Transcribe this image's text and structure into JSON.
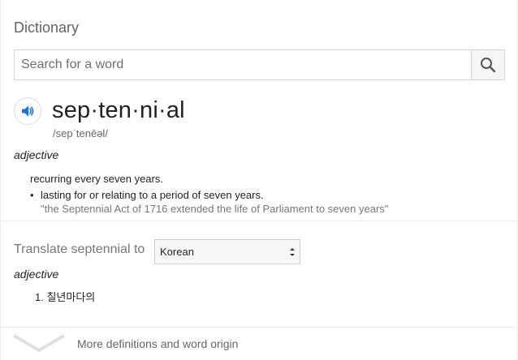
{
  "panel": {
    "title": "Dictionary"
  },
  "search": {
    "placeholder": "Search for a word",
    "value": "",
    "button_icon": "search-icon"
  },
  "entry": {
    "speaker_icon": "speaker-icon",
    "headword": "sep·ten·ni·al",
    "phonetic": "/sepˈtenēəl/",
    "part_of_speech": "adjective",
    "definition": "recurring every seven years.",
    "sub_definition": "lasting for or relating to a period of seven years.",
    "example": "\"the Septennial Act of 1716 extended the life of Parliament to seven years\""
  },
  "translate": {
    "label": "Translate septennial to",
    "selected_language": "Korean",
    "part_of_speech": "adjective",
    "items": [
      "1. 칠년마다의"
    ]
  },
  "footer": {
    "more_label": "More definitions and word origin",
    "chevron_icon": "chevron-down-icon"
  },
  "colors": {
    "accent_blue": "#1a73e8",
    "muted_text": "#777777",
    "border": "#d5d5d5"
  }
}
